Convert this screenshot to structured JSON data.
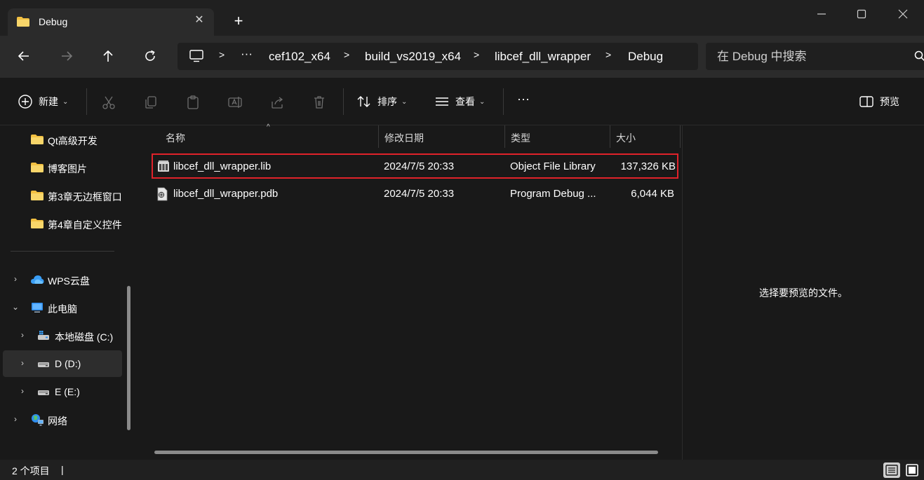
{
  "window": {
    "tab_title": "Debug",
    "new_tab": "+"
  },
  "address": {
    "overflow": "···",
    "crumbs": [
      "cef102_x64",
      "build_vs2019_x64",
      "libcef_dll_wrapper",
      "Debug"
    ],
    "sep": ">"
  },
  "search": {
    "placeholder": "在 Debug 中搜索"
  },
  "toolbar": {
    "new_label": "新建",
    "sort_label": "排序",
    "view_label": "查看",
    "more": "···",
    "preview_label": "预览"
  },
  "sidebar": {
    "items": [
      {
        "label": "Qt高级开发",
        "type": "folder"
      },
      {
        "label": "博客图片",
        "type": "folder"
      },
      {
        "label": "第3章无边框窗口",
        "type": "folder"
      },
      {
        "label": "第4章自定义控件",
        "type": "folder"
      },
      {
        "label": "WPS云盘",
        "type": "cloud"
      },
      {
        "label": "此电脑",
        "type": "pc"
      },
      {
        "label": "本地磁盘 (C:)",
        "type": "drive"
      },
      {
        "label": "D (D:)",
        "type": "drive",
        "selected": true
      },
      {
        "label": "E (E:)",
        "type": "drive"
      },
      {
        "label": "网络",
        "type": "network"
      }
    ]
  },
  "list": {
    "columns": {
      "name": "名称",
      "date": "修改日期",
      "type": "类型",
      "size": "大小"
    },
    "rows": [
      {
        "name": "libcef_dll_wrapper.lib",
        "date": "2024/7/5 20:33",
        "type": "Object File Library",
        "size": "137,326 KB",
        "highlighted": true
      },
      {
        "name": "libcef_dll_wrapper.pdb",
        "date": "2024/7/5 20:33",
        "type": "Program Debug ...",
        "size": "6,044 KB"
      }
    ]
  },
  "preview": {
    "message": "选择要预览的文件。"
  },
  "status": {
    "count": "2 个项目",
    "sep": "|"
  },
  "colors": {
    "background": "#191919",
    "titlebar": "#202020",
    "navrow": "#2b2b2b",
    "highlight_border": "#e0222a",
    "folder": "#f2c042"
  }
}
